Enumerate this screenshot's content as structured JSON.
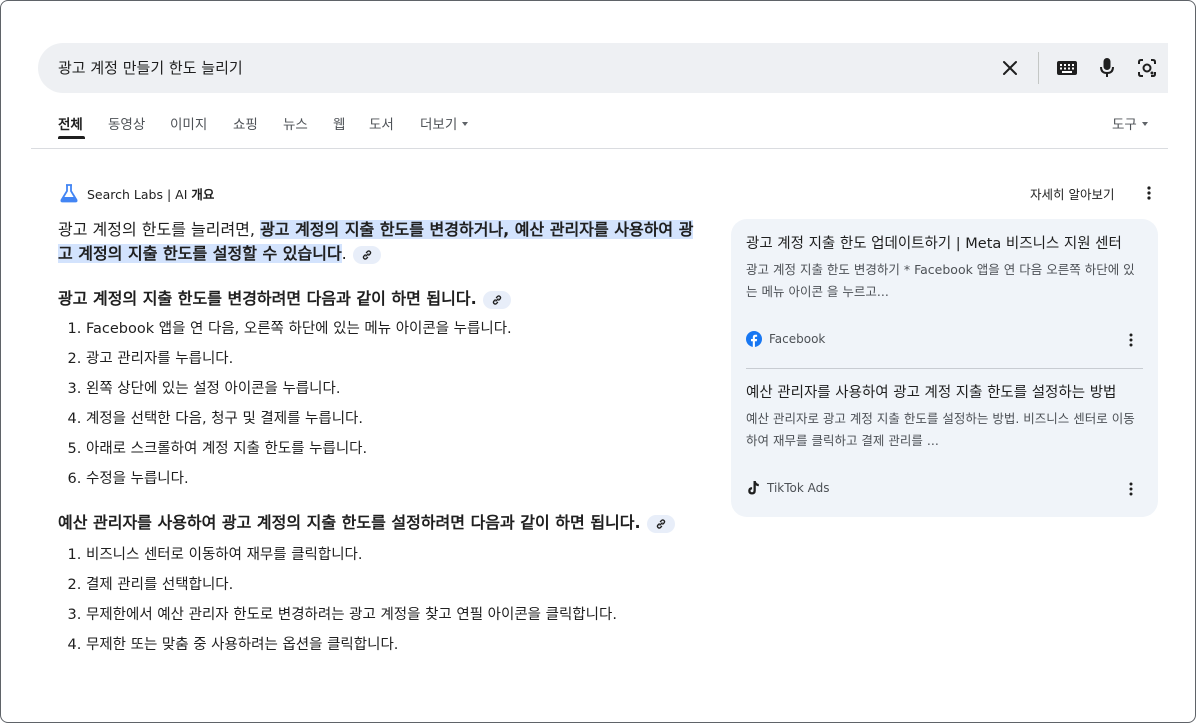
{
  "search": {
    "query": "광고 계정 만들기 한도 늘리기"
  },
  "tabs": [
    {
      "label": "전체",
      "active": true
    },
    {
      "label": "동영상"
    },
    {
      "label": "이미지"
    },
    {
      "label": "쇼핑"
    },
    {
      "label": "뉴스"
    },
    {
      "label": "웹"
    },
    {
      "label": "도서"
    },
    {
      "label": "더보기"
    }
  ],
  "tools_label": "도구",
  "ai_overview": {
    "brand": "Search Labs | AI",
    "brand_bold": "개요",
    "learn_more": "자세히 알아보기",
    "lead_plain": "광고 계정의 한도를 늘리려면, ",
    "lead_highlight": "광고 계정의 지출 한도를 변경하거나, 예산 관리자를 사용하여 광고 계정의 지출 한도를 설정할 수 있습니다",
    "lead_end": ".",
    "section1": {
      "heading": "광고 계정의 지출 한도를 변경하려면 다음과 같이 하면 됩니다.",
      "steps": [
        "Facebook 앱을 연 다음, 오른쪽 하단에 있는 메뉴 아이콘을 누릅니다.",
        "광고 관리자를 누릅니다.",
        "왼쪽 상단에 있는 설정 아이콘을 누릅니다.",
        "계정을 선택한 다음, 청구 및 결제를 누릅니다.",
        "아래로 스크롤하여 계정 지출 한도를 누릅니다.",
        "수정을 누릅니다."
      ]
    },
    "section2": {
      "heading": "예산 관리자를 사용하여 광고 계정의 지출 한도를 설정하려면 다음과 같이 하면 됩니다.",
      "steps": [
        "비즈니스 센터로 이동하여 재무를 클릭합니다.",
        "결제 관리를 선택합니다.",
        "무제한에서 예산 관리자 한도로 변경하려는 광고 계정을 찾고 연필 아이콘을 클릭합니다.",
        "무제한 또는 맞춤 중 사용하려는 옵션을 클릭합니다."
      ]
    }
  },
  "sources": [
    {
      "title": "광고 계정 지출 한도 업데이트하기 | Meta 비즈니스 지원 센터",
      "snippet": "광고 계정 지출 한도 변경하기 * Facebook 앱을 연 다음 오른쪽 하단에 있는 메뉴 아이콘 을 누르고...",
      "site": "Facebook",
      "site_icon": "facebook-icon"
    },
    {
      "title": "예산 관리자를 사용하여 광고 계정 지출 한도를 설정하는 방법",
      "snippet": "예산 관리자로 광고 계정 지출 한도를 설정하는 방법. 비즈니스 센터로 이동하여 재무를 클릭하고 결제 관리를 ...",
      "site": "TikTok Ads",
      "site_icon": "tiktok-icon"
    }
  ],
  "colors": {
    "highlight": "#d3e3fd",
    "panel": "#f0f4f9",
    "searchbar": "#eef0f3",
    "facebook": "#1877f2",
    "labs_blue": "#4285f4"
  }
}
